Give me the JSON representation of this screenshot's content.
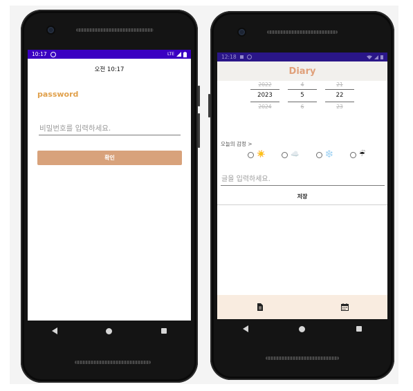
{
  "left_phone": {
    "status": {
      "time": "10:17",
      "network": "LTE"
    },
    "clock_title": "오전 10:17",
    "password_label": "password",
    "password_placeholder": "비밀번호를 입력하세요.",
    "confirm_label": "확인"
  },
  "right_phone": {
    "status": {
      "time": "12:18"
    },
    "app_title": "Diary",
    "date_picker": {
      "year": {
        "prev": "2022",
        "value": "2023",
        "next": "2024"
      },
      "month": {
        "prev": "4",
        "value": "5",
        "next": "6"
      },
      "day": {
        "prev": "21",
        "value": "22",
        "next": "23"
      }
    },
    "mood_label": "오늘의 감정  >",
    "moods": [
      {
        "name": "sunny",
        "icon": "☀️"
      },
      {
        "name": "cloudy",
        "icon": "☁️"
      },
      {
        "name": "snowy",
        "icon": "❄️"
      },
      {
        "name": "rainy",
        "icon": "☔"
      }
    ],
    "diary_placeholder": "글을 입력하세요.",
    "save_label": "저장",
    "bottom_tabs": [
      {
        "name": "document-icon"
      },
      {
        "name": "calendar-icon"
      }
    ]
  },
  "colors": {
    "status_bar": "#3b00c2",
    "accent_orange": "#e0a04b",
    "button_tan": "#d8a27b",
    "diary_title": "#e0a07a",
    "tab_bar": "#f9ece0"
  }
}
